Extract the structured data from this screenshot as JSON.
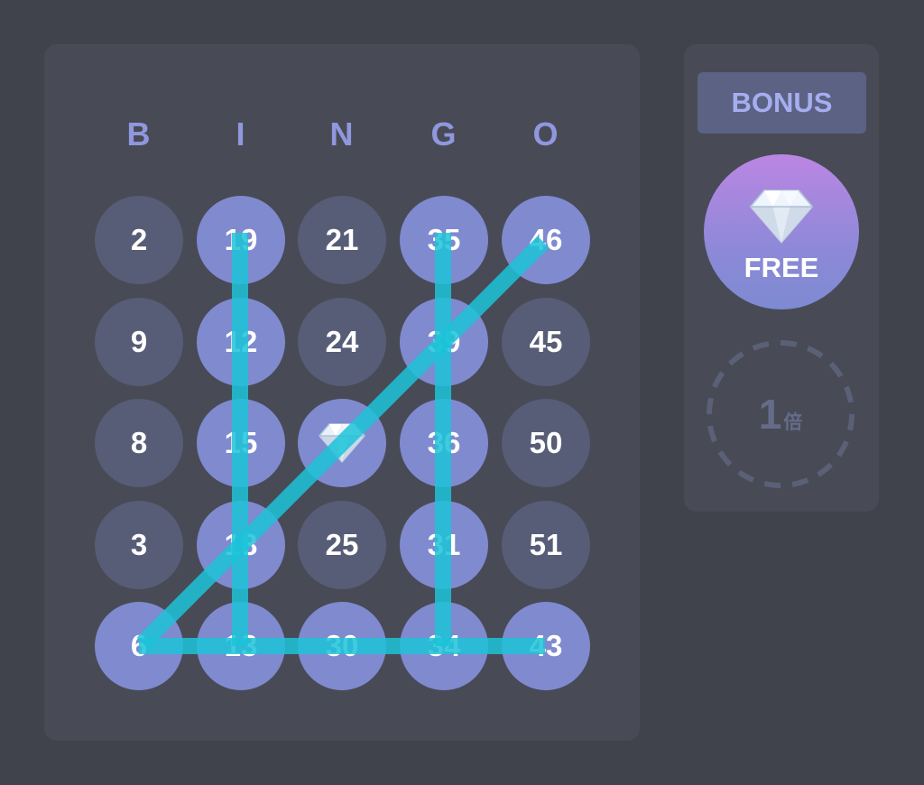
{
  "board": {
    "headers": [
      "B",
      "I",
      "N",
      "G",
      "O"
    ],
    "rows": [
      [
        {
          "value": "2",
          "marked": false
        },
        {
          "value": "19",
          "marked": true
        },
        {
          "value": "21",
          "marked": false
        },
        {
          "value": "35",
          "marked": true
        },
        {
          "value": "46",
          "marked": true
        }
      ],
      [
        {
          "value": "9",
          "marked": false
        },
        {
          "value": "12",
          "marked": true
        },
        {
          "value": "24",
          "marked": false
        },
        {
          "value": "39",
          "marked": true
        },
        {
          "value": "45",
          "marked": false
        }
      ],
      [
        {
          "value": "8",
          "marked": false
        },
        {
          "value": "15",
          "marked": true
        },
        {
          "value": "",
          "marked": true,
          "icon": "diamond-icon"
        },
        {
          "value": "36",
          "marked": true
        },
        {
          "value": "50",
          "marked": false
        }
      ],
      [
        {
          "value": "3",
          "marked": false
        },
        {
          "value": "18",
          "marked": true
        },
        {
          "value": "25",
          "marked": false
        },
        {
          "value": "31",
          "marked": true
        },
        {
          "value": "51",
          "marked": false
        }
      ],
      [
        {
          "value": "6",
          "marked": true
        },
        {
          "value": "13",
          "marked": true
        },
        {
          "value": "30",
          "marked": true
        },
        {
          "value": "34",
          "marked": true
        },
        {
          "value": "43",
          "marked": true
        }
      ]
    ],
    "winning_lines": [
      "column-I",
      "column-G",
      "row-5",
      "diagonal-6-to-46"
    ]
  },
  "side": {
    "bonus_label": "BONUS",
    "free_label": "FREE",
    "free_icon": "diamond-icon",
    "multiplier_value": "1",
    "multiplier_unit": "倍"
  },
  "colors": {
    "background": "#41434c",
    "panel": "#484a56",
    "cell_unmarked": "#575d77",
    "cell_marked": "#7f8acf",
    "header_letter": "#8f97dd",
    "win_line": "#1cc3d8",
    "bonus_text": "#a5aef0",
    "free_gradient_top": "#bb86e3",
    "free_gradient_bottom": "#7d8ad1"
  }
}
